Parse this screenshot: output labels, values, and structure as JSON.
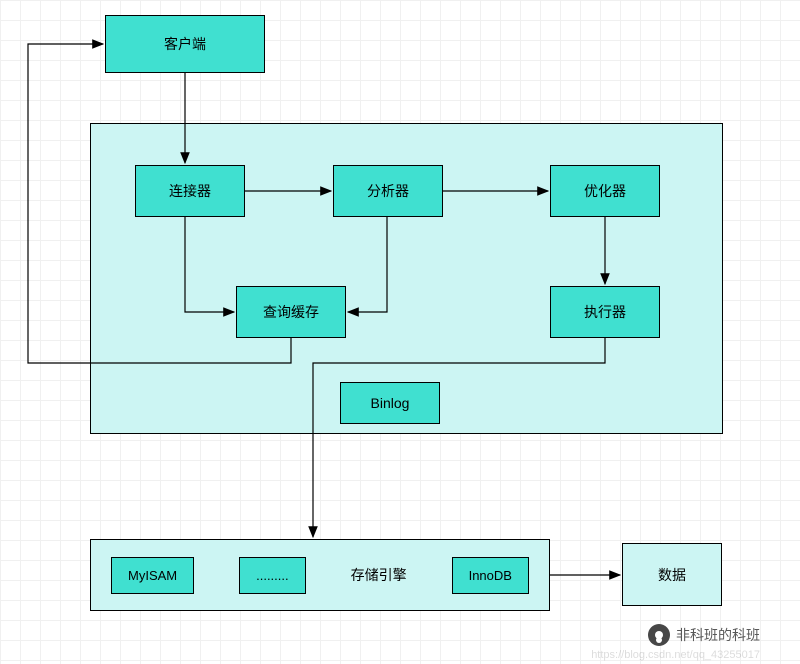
{
  "nodes": {
    "client": "客户端",
    "connector": "连接器",
    "analyzer": "分析器",
    "optimizer": "优化器",
    "query_cache": "查询缓存",
    "executor": "执行器",
    "binlog": "Binlog",
    "storage_label": "存储引擎",
    "myisam": "MyISAM",
    "ellipsis": ".........",
    "innodb": "InnoDB",
    "data": "数据"
  },
  "watermark": {
    "text": "非科班的科班",
    "url": "https://blog.csdn.net/qq_43255017"
  },
  "icons": {
    "wechat": "wechat-icon"
  }
}
